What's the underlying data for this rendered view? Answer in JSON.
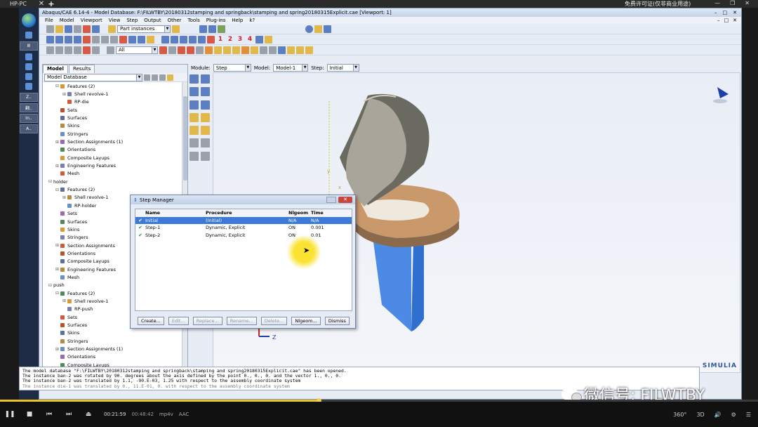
{
  "topbar": {
    "host": "HP-PC",
    "license": "免费许可证(仅非商业用途)"
  },
  "taskbar": {
    "items": [
      "Ⅲ",
      "Z..",
      "翻..",
      "In..",
      "A.."
    ]
  },
  "window": {
    "title": "Abaqus/CAE 6.14-4 - Model Database: F:\\FILWTBY\\20180312stamping and springback\\stamping and spring20180315Explicit.cae [Viewport: 1]"
  },
  "menu": [
    "File",
    "Model",
    "Viewport",
    "View",
    "Step",
    "Output",
    "Other",
    "Tools",
    "Plug-ins",
    "Help",
    "k?"
  ],
  "toolbar": {
    "part_instances": "Part instances",
    "filter_all": "All"
  },
  "module_bar": {
    "module_label": "Module:",
    "module": "Step",
    "model_label": "Model:",
    "model": "Model-1",
    "step_label": "Step:",
    "step": "Initial"
  },
  "tree": {
    "tabs": [
      "Model",
      "Results"
    ],
    "selector": "Model Database",
    "nodes": [
      {
        "label": "Features (2)",
        "indent": 2,
        "exp": "⊟"
      },
      {
        "label": "Shell revolve-1",
        "indent": 3,
        "exp": "⊞"
      },
      {
        "label": "RP-die",
        "indent": 3,
        "exp": ""
      },
      {
        "label": "Sets",
        "indent": 2,
        "exp": ""
      },
      {
        "label": "Surfaces",
        "indent": 2,
        "exp": ""
      },
      {
        "label": "Skins",
        "indent": 2,
        "exp": ""
      },
      {
        "label": "Stringers",
        "indent": 2,
        "exp": ""
      },
      {
        "label": "Section Assignments (1)",
        "indent": 2,
        "exp": "⊞"
      },
      {
        "label": "Orientations",
        "indent": 2,
        "exp": ""
      },
      {
        "label": "Composite Layups",
        "indent": 2,
        "exp": ""
      },
      {
        "label": "Engineering Features",
        "indent": 2,
        "exp": "⊞"
      },
      {
        "label": "Mesh",
        "indent": 2,
        "exp": ""
      },
      {
        "label": "holder",
        "indent": 1,
        "exp": "⊟"
      },
      {
        "label": "Features (2)",
        "indent": 2,
        "exp": "⊟"
      },
      {
        "label": "Shell revolve-1",
        "indent": 3,
        "exp": "⊞"
      },
      {
        "label": "RP-holder",
        "indent": 3,
        "exp": ""
      },
      {
        "label": "Sets",
        "indent": 2,
        "exp": ""
      },
      {
        "label": "Surfaces",
        "indent": 2,
        "exp": ""
      },
      {
        "label": "Skins",
        "indent": 2,
        "exp": ""
      },
      {
        "label": "Stringers",
        "indent": 2,
        "exp": ""
      },
      {
        "label": "Section Assignments",
        "indent": 2,
        "exp": "⊞"
      },
      {
        "label": "Orientations",
        "indent": 2,
        "exp": ""
      },
      {
        "label": "Composite Layups",
        "indent": 2,
        "exp": ""
      },
      {
        "label": "Engineering Features",
        "indent": 2,
        "exp": "⊞"
      },
      {
        "label": "Mesh",
        "indent": 2,
        "exp": ""
      },
      {
        "label": "push",
        "indent": 1,
        "exp": "⊟"
      },
      {
        "label": "Features (2)",
        "indent": 2,
        "exp": "⊟"
      },
      {
        "label": "Shell revolve-1",
        "indent": 3,
        "exp": "⊞"
      },
      {
        "label": "RP-push",
        "indent": 3,
        "exp": ""
      },
      {
        "label": "Sets",
        "indent": 2,
        "exp": ""
      },
      {
        "label": "Surfaces",
        "indent": 2,
        "exp": ""
      },
      {
        "label": "Skins",
        "indent": 2,
        "exp": ""
      },
      {
        "label": "Stringers",
        "indent": 2,
        "exp": ""
      },
      {
        "label": "Section Assignments (1)",
        "indent": 2,
        "exp": "⊞"
      },
      {
        "label": "Orientations",
        "indent": 2,
        "exp": ""
      },
      {
        "label": "Composite Layups",
        "indent": 2,
        "exp": ""
      }
    ]
  },
  "step_manager": {
    "title": "Step Manager",
    "columns": [
      "Name",
      "Procedure",
      "Nlgeom",
      "Time"
    ],
    "rows": [
      {
        "check": "✔",
        "name": "Initial",
        "procedure": "(Initial)",
        "nlgeom": "N/A",
        "time": "N/A",
        "selected": true
      },
      {
        "check": "✔",
        "name": "Step-1",
        "procedure": "Dynamic, Explicit",
        "nlgeom": "ON",
        "time": "0.001",
        "selected": false
      },
      {
        "check": "✔",
        "name": "Step-2",
        "procedure": "Dynamic, Explicit",
        "nlgeom": "ON",
        "time": "0.01",
        "selected": false
      }
    ],
    "buttons": {
      "create": "Create...",
      "edit": "Edit...",
      "replace": "Replace...",
      "rename": "Rename...",
      "delete": "Delete...",
      "nlgeom": "Nlgeom...",
      "dismiss": "Dismiss"
    }
  },
  "viewport": {
    "brand": "SIMULIA",
    "axis_z": "Z",
    "axis_y": "y",
    "axis_x": "x"
  },
  "messages": [
    "The model database \"F:\\FILWTBY\\20180312stamping and springback\\stamping and spring20180315Explicit.cae\" has been opened.",
    "The instance ban-2 was rotated by 90. degrees about the axis defined by the point 0., 0., 0. and the vector 1., 0., 0.",
    "The instance ban-2 was translated by 1.1, -90.E-03, 1.25 with respect to the assembly coordinate system",
    "The instance die-1 was translated by 0., 11.E-01, 0. with respect to the assembly coordinate system"
  ],
  "player": {
    "elapsed": "00:21:59",
    "duration": "00:48:42",
    "format": "mp4v",
    "audio": "AAC",
    "progress": 0.42,
    "right_controls": [
      "360°",
      "3D"
    ]
  },
  "watermark": {
    "text": "微信号: FILWTBY"
  }
}
